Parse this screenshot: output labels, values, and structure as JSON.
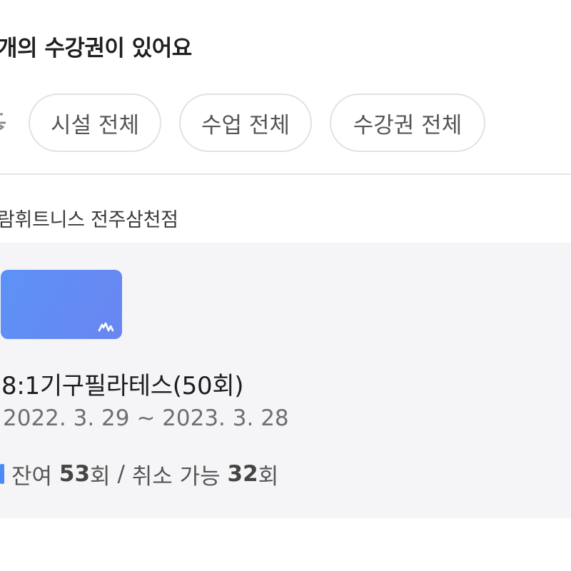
{
  "header": {
    "title": "개의 수강권이 있어요"
  },
  "filters": {
    "edge_icon": "filter-icon",
    "chips": [
      {
        "label": "시설 전체"
      },
      {
        "label": "수업 전체"
      },
      {
        "label": "수강권 전체"
      }
    ]
  },
  "facility": {
    "name": "람휘트니스 전주삼천점"
  },
  "pass": {
    "thumbnail_color_start": "#5c92f7",
    "thumbnail_color_end": "#6a86f0",
    "title": "8:1기구필라테스(50회)",
    "period": "2022. 3. 29 ~ 2023. 3. 28",
    "remaining_label": "잔여",
    "remaining_count": "53",
    "count_unit": "회",
    "separator": "/",
    "cancelable_label": "취소 가능",
    "cancelable_count": "32",
    "marker_color": "#4a8cf6"
  }
}
